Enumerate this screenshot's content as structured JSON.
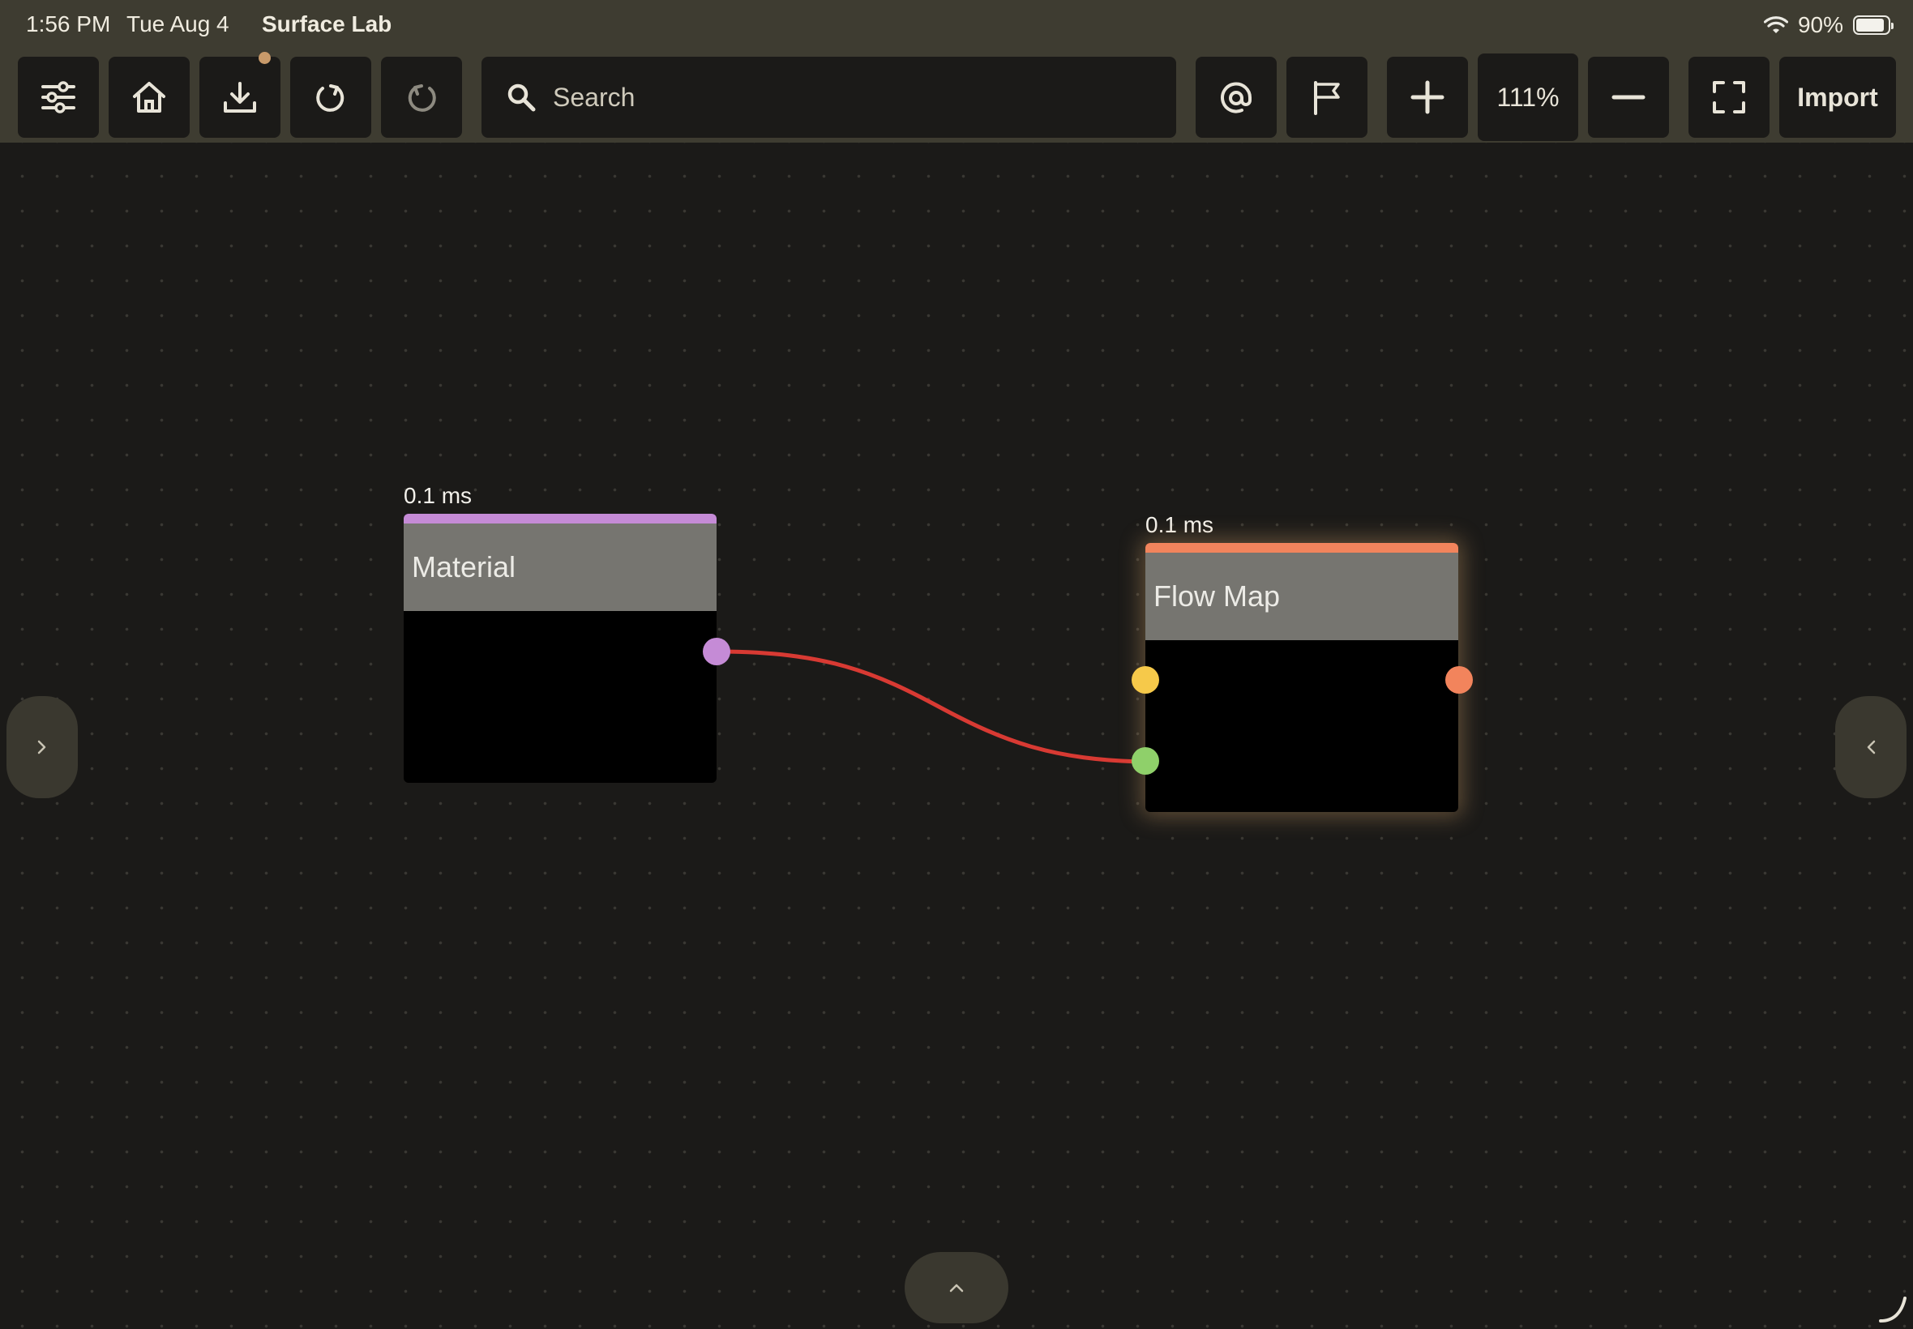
{
  "status_bar": {
    "time": "1:56 PM",
    "date": "Tue Aug 4",
    "app_name": "Surface Lab",
    "battery": "90%",
    "battery_level": 0.9
  },
  "toolbar": {
    "icons": [
      "sliders-icon",
      "home-icon",
      "download-icon",
      "redo-icon",
      "undo-icon",
      "at-icon",
      "flag-icon",
      "plus-icon",
      "minus-icon",
      "fullscreen-icon"
    ],
    "search_placeholder": "Search",
    "zoom_level": "111%",
    "import_label": "Import"
  },
  "nodes": [
    {
      "title": "Material",
      "time": "0.1 ms",
      "accent": "#c58bd6",
      "ports": [
        {
          "side": "output",
          "color": "#c58bd6"
        }
      ]
    },
    {
      "title": "Flow Map",
      "time": "0.1 ms",
      "accent": "#f2845c",
      "ports": [
        {
          "side": "input",
          "color": "#f6c94a"
        },
        {
          "side": "input",
          "color": "#8fd06a"
        },
        {
          "side": "output",
          "color": "#f2845c"
        }
      ]
    }
  ],
  "connection": {
    "color": "#d83a33"
  },
  "colors": {
    "toolbar_bg": "#3e3c31",
    "canvas_bg": "#1b1a18",
    "button_bg": "#1b1a18",
    "node_header": "#767570"
  }
}
